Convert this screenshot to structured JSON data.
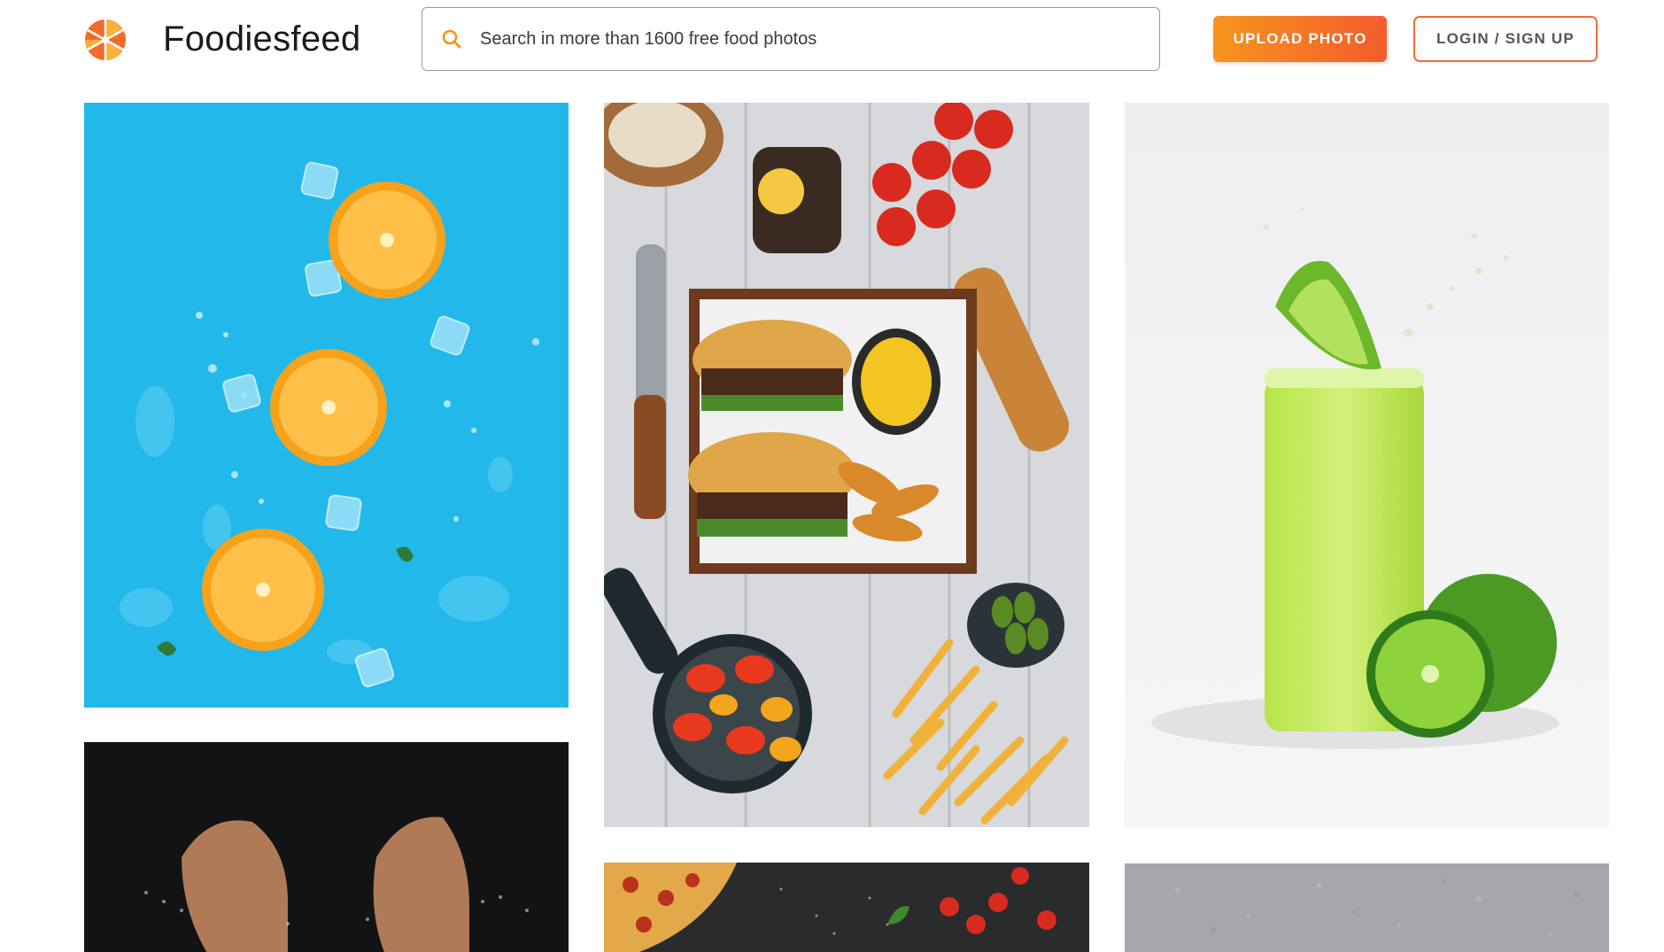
{
  "header": {
    "logo_icon": "camera-aperture-icon",
    "brand": "Foodiesfeed",
    "search": {
      "icon": "search-icon",
      "placeholder": "Search in more than 1600 free food photos",
      "value": ""
    },
    "upload_label": "UPLOAD PHOTO",
    "login_label": "LOGIN / SIGN UP"
  },
  "colors": {
    "accent_orange": "#f7941d",
    "accent_red": "#f45c2c",
    "text_dark": "#1a1a1a"
  },
  "photos": [
    {
      "subject": "orange slices on blue background"
    },
    {
      "subject": "burgers, fries, peppers and tomatoes on wooden table"
    },
    {
      "subject": "lime juice with lime halves"
    },
    {
      "subject": "hands with flour on black background"
    },
    {
      "subject": "pizza and cherry tomatoes on dark background"
    },
    {
      "subject": "grey stone surface"
    }
  ]
}
